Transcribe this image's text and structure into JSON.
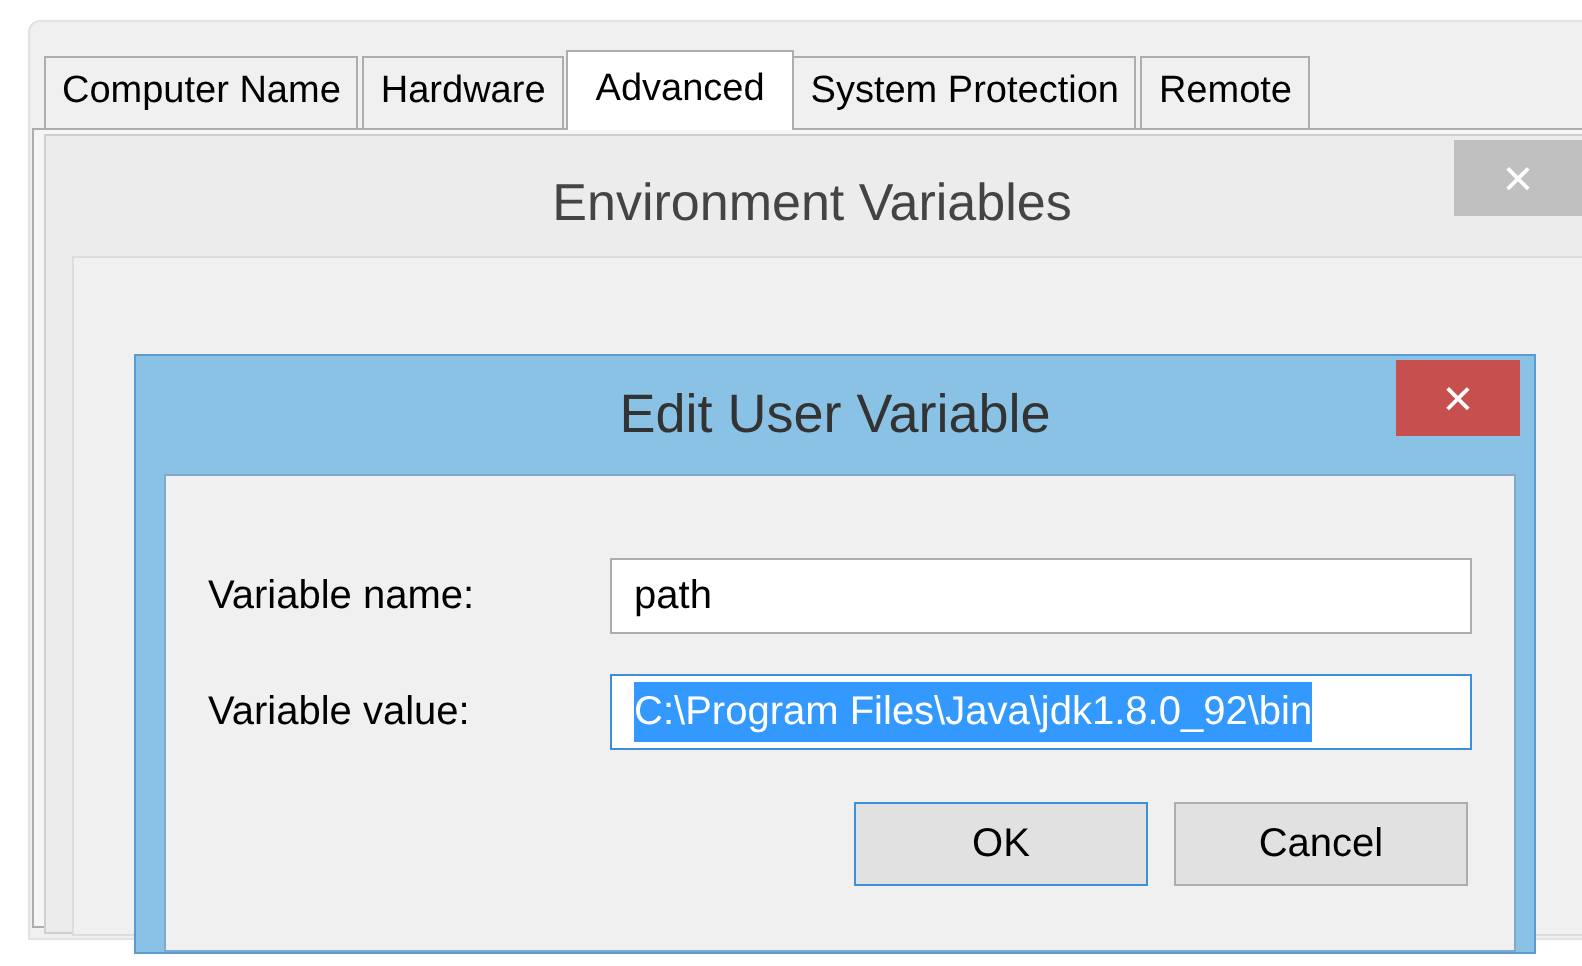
{
  "tabs": [
    {
      "label": "Computer Name",
      "selected": false
    },
    {
      "label": "Hardware",
      "selected": false
    },
    {
      "label": "Advanced",
      "selected": true
    },
    {
      "label": "System Protection",
      "selected": false
    },
    {
      "label": "Remote",
      "selected": false
    }
  ],
  "environment_window": {
    "title": "Environment Variables",
    "close": "×"
  },
  "dialog": {
    "title": "Edit User Variable",
    "close": "×",
    "fields": [
      {
        "label": "Variable name:",
        "value": "path",
        "text_selected": false,
        "focused": false
      },
      {
        "label": "Variable value:",
        "value": "C:\\Program Files\\Java\\jdk1.8.0_92\\bin",
        "text_selected": true,
        "focused": true
      }
    ],
    "buttons": [
      {
        "label": "OK",
        "default": true
      },
      {
        "label": "Cancel",
        "default": false
      }
    ]
  }
}
